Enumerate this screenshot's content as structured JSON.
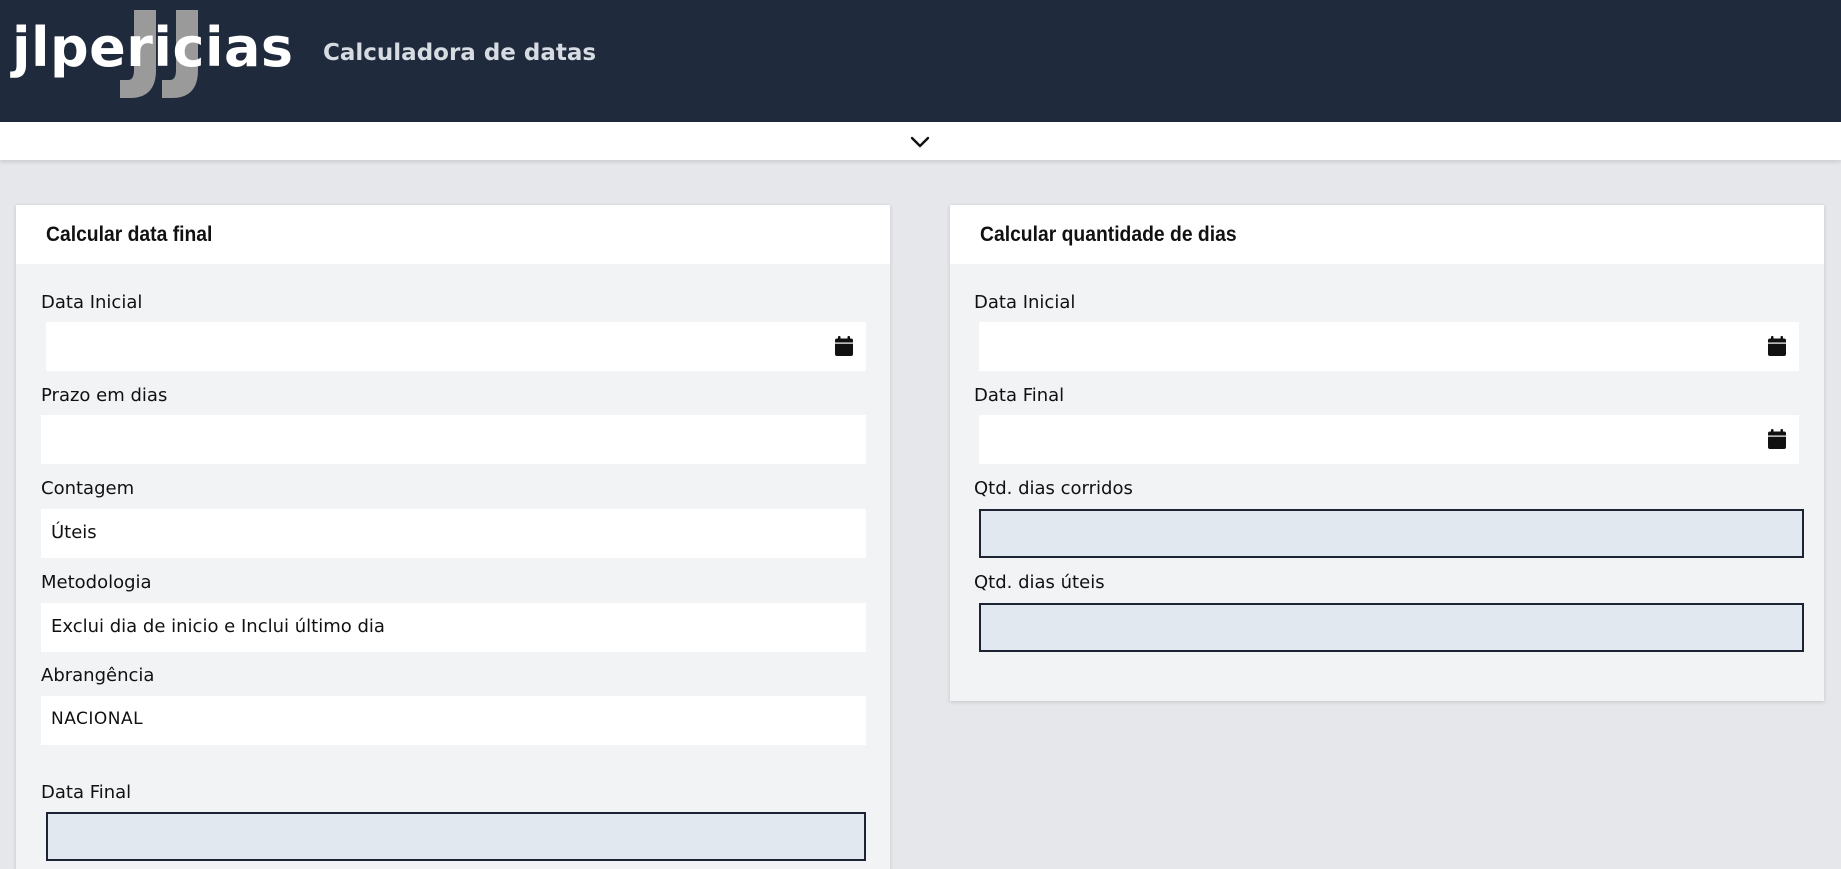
{
  "header": {
    "logo_text": "jlpericias",
    "app_title": "Calculadora de datas"
  },
  "colors": {
    "topbar": "#1f2a3c",
    "background": "#e5e7eb",
    "output_fill": "#e2e8f0"
  },
  "left_card": {
    "title": "Calcular data final",
    "data_inicial_label": "Data Inicial",
    "data_inicial_value": "",
    "prazo_label": "Prazo em dias",
    "prazo_value": "",
    "contagem_label": "Contagem",
    "contagem_value": "Úteis",
    "metodologia_label": "Metodologia",
    "metodologia_value": "Exclui dia de inicio e Inclui último dia",
    "abrangencia_label": "Abrangência",
    "abrangencia_value": "NACIONAL",
    "data_final_label": "Data Final",
    "data_final_value": ""
  },
  "right_card": {
    "title": "Calcular quantidade de dias",
    "data_inicial_label": "Data Inicial",
    "data_inicial_value": "",
    "data_final_label": "Data Final",
    "data_final_value": "",
    "dias_corridos_label": "Qtd. dias corridos",
    "dias_corridos_value": "",
    "dias_uteis_label": "Qtd. dias úteis",
    "dias_uteis_value": ""
  },
  "icons": {
    "collapse": "chevron-down-icon",
    "date_picker": "calendar-icon"
  }
}
